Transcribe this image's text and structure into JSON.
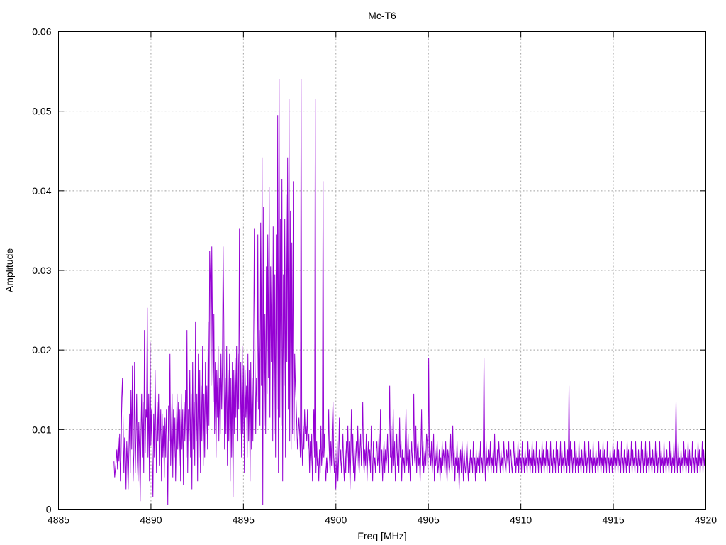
{
  "chart_data": {
    "type": "line",
    "title": "Mc-T6",
    "xlabel": "Freq [MHz]",
    "ylabel": "Amplitude",
    "xlim": [
      4885,
      4920
    ],
    "ylim": [
      0,
      0.06
    ],
    "xticks": [
      4885,
      4890,
      4895,
      4900,
      4905,
      4910,
      4915,
      4920
    ],
    "xtick_labels": [
      "4885",
      "4890",
      "4895",
      "4900",
      "4905",
      "4910",
      "4915",
      "4920"
    ],
    "yticks": [
      0,
      0.01,
      0.02,
      0.03,
      0.04,
      0.05,
      0.06
    ],
    "ytick_labels": [
      "0",
      "0.01",
      "0.02",
      "0.03",
      "0.04",
      "0.05",
      "0.06"
    ],
    "grid": true,
    "series_color": "#9400d3",
    "series": [
      {
        "x_range": [
          4888.0,
          4920.0
        ],
        "values": [
          0.006,
          0.004,
          0.005,
          0.006,
          0.0075,
          0.005,
          0.009,
          0.006,
          0.0095,
          0.0035,
          0.007,
          0.014,
          0.0165,
          0.0105,
          0.0045,
          0.009,
          0.0075,
          0.0025,
          0.0085,
          0.006,
          0.0025,
          0.007,
          0.012,
          0.0045,
          0.015,
          0.0075,
          0.018,
          0.0035,
          0.007,
          0.0185,
          0.0045,
          0.009,
          0.0145,
          0.006,
          0.0035,
          0.011,
          0.0075,
          0.001,
          0.009,
          0.0145,
          0.0065,
          0.0135,
          0.0045,
          0.0225,
          0.007,
          0.0125,
          0.0115,
          0.0253,
          0.0065,
          0.0145,
          0.0035,
          0.021,
          0.008,
          0.0125,
          0.0065,
          0.0015,
          0.012,
          0.0065,
          0.0175,
          0.0105,
          0.0045,
          0.0135,
          0.0085,
          0.0145,
          0.0055,
          0.009,
          0.0125,
          0.0035,
          0.012,
          0.0065,
          0.0105,
          0.004,
          0.0115,
          0.0065,
          0.0125,
          0.0085,
          0.0005,
          0.013,
          0.0085,
          0.0195,
          0.0055,
          0.0095,
          0.0145,
          0.004,
          0.0125,
          0.0065,
          0.0115,
          0.0035,
          0.009,
          0.0145,
          0.0075,
          0.0135,
          0.0055,
          0.0125,
          0.0035,
          0.0145,
          0.0075,
          0.0125,
          0.003,
          0.0135,
          0.0085,
          0.015,
          0.0065,
          0.0225,
          0.0045,
          0.0125,
          0.0085,
          0.0175,
          0.0065,
          0.0145,
          0.0025,
          0.0185,
          0.0075,
          0.0135,
          0.0055,
          0.0235,
          0.0085,
          0.0145,
          0.0035,
          0.0195,
          0.0065,
          0.0175,
          0.0045,
          0.0155,
          0.0085,
          0.0205,
          0.0055,
          0.0145,
          0.0065,
          0.0185,
          0.0095,
          0.0155,
          0.0075,
          0.0235,
          0.0105,
          0.0325,
          0.0285,
          0.0155,
          0.033,
          0.0225,
          0.0135,
          0.0245,
          0.0095,
          0.0185,
          0.0065,
          0.0175,
          0.0115,
          0.0205,
          0.0085,
          0.0165,
          0.0095,
          0.0195,
          0.0125,
          0.018,
          0.0095,
          0.0235,
          0.0075,
          0.0165,
          0.0095,
          0.0205,
          0.0055,
          0.0175,
          0.0085,
          0.0195,
          0.0035,
          0.0165,
          0.0065,
          0.0185,
          0.0015,
          0.0175,
          0.0095,
          0.019,
          0.0115,
          0.0205,
          0.0085,
          0.0195,
          0.0125,
          0.0353,
          0.0095,
          0.0185,
          0.0065,
          0.0205,
          0.0095,
          0.018,
          0.0045,
          0.0175,
          0.0115,
          0.0155,
          0.0065,
          0.0195,
          0.0085,
          0.0175,
          0.0035,
          0.0185,
          0.0075,
          0.0165,
          0.0085,
          0.0195,
          0.0115,
          0.0185,
          0.0095,
          0.0165,
          0.0135,
          0.0345,
          0.0125,
          0.0225,
          0.0105,
          0.036,
          0.0155,
          0.0442,
          0.0005,
          0.038,
          0.0105,
          0.0245,
          0.0095,
          0.0305,
          0.0145,
          0.0345,
          0.0165,
          0.0405,
          0.0115,
          0.0305,
          0.0185,
          0.0355,
          0.0085,
          0.0355,
          0.0095,
          0.0295,
          0.0065,
          0.0345,
          0.0125,
          0.0495,
          0.0045,
          0.054,
          0.0115,
          0.0365,
          0.0105,
          0.0415,
          0.0035,
          0.0295,
          0.0155,
          0.0365,
          0.0065,
          0.0395,
          0.0185,
          0.0335,
          0.0125,
          0.0515,
          0.0085,
          0.0375,
          0.0075,
          0.0335,
          0.0095,
          0.0412,
          0.0085,
          0.0195,
          0.0155,
          0.0135,
          0.0105,
          0.0075,
          0.0095,
          0.0115,
          0.0095,
          0.0065,
          0.0035,
          0.0085,
          0.0055,
          0.0105,
          0.0075,
          0.0125,
          0.0095,
          0.0105,
          0.0085,
          0.0125,
          0.0075,
          0.0095,
          0.0045,
          0.0085,
          0.0055,
          0.0095,
          0.0035,
          0.0075,
          0.0125,
          0.0065,
          0.0145,
          0.0045,
          0.0085,
          0.0055,
          0.0065,
          0.0035,
          0.0075,
          0.0045,
          0.0105,
          0.0055,
          0.0075,
          0.0025,
          0.0065,
          0.0095,
          0.0055,
          0.0035,
          0.0065,
          0.0045,
          0.0075,
          0.0125,
          0.0065,
          0.0045,
          0.0085,
          0.0055,
          0.0105,
          0.0135,
          0.0065,
          0.0045,
          0.0075,
          0.0025,
          0.0055,
          0.0085,
          0.0035,
          0.0065,
          0.0115,
          0.0055,
          0.0075,
          0.0045,
          0.0065,
          0.0095,
          0.0055,
          0.0035,
          0.0075,
          0.0045,
          0.0085,
          0.0065,
          0.0105,
          0.0045,
          0.0085,
          0.0025,
          0.0065,
          0.0125,
          0.0055,
          0.0095,
          0.0045,
          0.0075,
          0.0035,
          0.0065,
          0.0085,
          0.0055,
          0.0105,
          0.0065,
          0.0045,
          0.0075,
          0.0095,
          0.0055,
          0.0085,
          0.0135,
          0.0065,
          0.0045,
          0.0075,
          0.0055,
          0.0095,
          0.0035,
          0.0065,
          0.0085,
          0.0055,
          0.0075,
          0.0045,
          0.0105,
          0.0065,
          0.0035,
          0.0085,
          0.0055,
          0.0065,
          0.0045,
          0.0075,
          0.0085,
          0.0055,
          0.0065,
          0.0095,
          0.0045,
          0.0125,
          0.0055,
          0.0075,
          0.0035,
          0.0065,
          0.0085,
          0.0045,
          0.0075,
          0.0055,
          0.0065,
          0.0095,
          0.0045,
          0.0085,
          0.0155,
          0.0065,
          0.0105,
          0.0045,
          0.0075,
          0.0125,
          0.0055,
          0.0085,
          0.0035,
          0.0065,
          0.0095,
          0.0055,
          0.0075,
          0.0045,
          0.0115,
          0.0065,
          0.0085,
          0.0035,
          0.0075,
          0.0055,
          0.0065,
          0.0045,
          0.0085,
          0.0125,
          0.0055,
          0.0065,
          0.0095,
          0.0045,
          0.0075,
          0.0035,
          0.0065,
          0.0085,
          0.0055,
          0.0075,
          0.0145,
          0.0065,
          0.0055,
          0.0105,
          0.0045,
          0.0075,
          0.0085,
          0.0055,
          0.0065,
          0.0035,
          0.0075,
          0.0125,
          0.0055,
          0.0085,
          0.0045,
          0.0065,
          0.0075,
          0.0055,
          0.0095,
          0.0085,
          0.0045,
          0.019,
          0.0065,
          0.0075,
          0.0055,
          0.0085,
          0.0045,
          0.0065,
          0.0095,
          0.0035,
          0.0075,
          0.0055,
          0.0065,
          0.0085,
          0.0045,
          0.0055,
          0.0075,
          0.0035,
          0.0065,
          0.0045,
          0.0085,
          0.0055,
          0.0075,
          0.0065,
          0.0045,
          0.0085,
          0.0055,
          0.0035,
          0.0075,
          0.0065,
          0.0045,
          0.0055,
          0.0095,
          0.0065,
          0.0045,
          0.0105,
          0.0055,
          0.0075,
          0.0035,
          0.0065,
          0.0055,
          0.0085,
          0.0045,
          0.0065,
          0.0025,
          0.0055,
          0.0075,
          0.0045,
          0.0085,
          0.0065,
          0.0035,
          0.0075,
          0.0055,
          0.0045,
          0.0065,
          0.0085,
          0.0055,
          0.0035,
          0.0065,
          0.0045,
          0.0075,
          0.0055,
          0.0065,
          0.0045,
          0.0085,
          0.0055,
          0.0065,
          0.0035,
          0.0075,
          0.0045,
          0.0065,
          0.0055,
          0.0075,
          0.0045,
          0.0085,
          0.0055,
          0.0065,
          0.0045,
          0.0075,
          0.0055,
          0.0065,
          0.0035,
          0.0085,
          0.0055,
          0.0065,
          0.0045,
          0.0075,
          0.0055,
          0.0085,
          0.0045,
          0.0065,
          0.0055,
          0.0075,
          0.0045,
          0.0095,
          0.0055,
          0.0065,
          0.0045,
          0.0075,
          0.0055,
          0.0085,
          0.0065,
          0.0045,
          0.0075,
          0.0055,
          0.0065,
          0.0045,
          0.0085,
          0.0065,
          0.0055,
          0.0045,
          0.0075,
          0.0065,
          0.0055,
          0.0085,
          0.0045,
          0.0065,
          0.0075,
          0.0055,
          0.0045,
          0.0065,
          0.0085,
          0.0055,
          0.0075,
          0.0045,
          0.0065,
          0.0055,
          0.0085,
          0.0045,
          0.0075,
          0.0055,
          0.0065,
          0.0045,
          0.0085,
          0.0055,
          0.0065,
          0.0045,
          0.0075,
          0.0055,
          0.0065,
          0.0045,
          0.0085,
          0.0055,
          0.0075,
          0.0045,
          0.0065,
          0.0055,
          0.0085,
          0.0045,
          0.0075,
          0.0055,
          0.0065,
          0.0045,
          0.0085,
          0.0055,
          0.0065,
          0.0045,
          0.0075,
          0.0055,
          0.0065,
          0.0045,
          0.0085,
          0.0055,
          0.0075,
          0.0045,
          0.0065,
          0.0055,
          0.0085,
          0.0045,
          0.0075,
          0.0055,
          0.0065,
          0.0045,
          0.0085,
          0.0055,
          0.0065,
          0.0045,
          0.0075,
          0.0055,
          0.0065,
          0.0045,
          0.0085,
          0.0055,
          0.0075,
          0.0045,
          0.0065,
          0.0055,
          0.0085,
          0.0045,
          0.0075,
          0.0055,
          0.0065,
          0.0045,
          0.0085,
          0.0055,
          0.0065,
          0.0045,
          0.0075,
          0.0055,
          0.0065,
          0.0045,
          0.0085,
          0.0055,
          0.0075,
          0.0045,
          0.0065,
          0.0055,
          0.0085,
          0.0045,
          0.0075,
          0.0055,
          0.0065,
          0.0045,
          0.0085,
          0.0055,
          0.0065,
          0.0045,
          0.0075,
          0.0055,
          0.0065,
          0.0045,
          0.0085,
          0.0055,
          0.0075,
          0.0045,
          0.0065,
          0.0055,
          0.0085,
          0.0045,
          0.0075,
          0.0055,
          0.0065,
          0.0045,
          0.0085,
          0.0055,
          0.0065,
          0.0045,
          0.0075,
          0.0055,
          0.0065,
          0.0045,
          0.0085,
          0.0055,
          0.0075,
          0.0045,
          0.0065,
          0.0055,
          0.0085,
          0.0045,
          0.0075,
          0.0055,
          0.0065,
          0.0045,
          0.0085,
          0.0055,
          0.0065,
          0.0045,
          0.0075,
          0.0055,
          0.0065,
          0.0045,
          0.0085,
          0.0055,
          0.0075,
          0.0045,
          0.0065,
          0.0055,
          0.0085,
          0.0045,
          0.0075,
          0.0055,
          0.0065,
          0.0045,
          0.0085,
          0.0055,
          0.0065,
          0.0045,
          0.0075,
          0.0055,
          0.0065,
          0.0045,
          0.0085,
          0.0055,
          0.0075,
          0.0045,
          0.0065,
          0.0055,
          0.0085,
          0.0045,
          0.0075,
          0.0055,
          0.0065,
          0.0045,
          0.0085,
          0.0055,
          0.0065,
          0.0045,
          0.0075,
          0.0055,
          0.0065,
          0.0045,
          0.0085,
          0.0055,
          0.0075,
          0.0045,
          0.0065,
          0.0055,
          0.0085,
          0.0045,
          0.0075,
          0.0055,
          0.0065,
          0.0045,
          0.0085,
          0.0055,
          0.0065,
          0.0045,
          0.0075,
          0.0055,
          0.0065,
          0.0045,
          0.0085,
          0.0055,
          0.0075,
          0.0045,
          0.0065,
          0.0055,
          0.0085,
          0.0045,
          0.0075,
          0.0055,
          0.0065,
          0.0045,
          0.0085,
          0.0055,
          0.0065,
          0.0045,
          0.0075,
          0.0055,
          0.0065,
          0.0045,
          0.0085,
          0.0055,
          0.0075,
          0.0045,
          0.0065,
          0.0055,
          0.0085,
          0.0045,
          0.0075,
          0.0055,
          0.0065,
          0.0045,
          0.0085,
          0.0055,
          0.0065,
          0.0045,
          0.0075,
          0.0055,
          0.0065,
          0.0045,
          0.0085,
          0.0055,
          0.0075,
          0.0045,
          0.0065,
          0.0055,
          0.0085,
          0.0045,
          0.0075,
          0.0055,
          0.0065,
          0.0045,
          0.0085,
          0.0055,
          0.0065,
          0.0045,
          0.0075,
          0.0055,
          0.0065,
          0.0045,
          0.0085,
          0.0055,
          0.0075,
          0.0045,
          0.0065,
          0.0055,
          0.0085,
          0.0045,
          0.0075,
          0.0055,
          0.0065,
          0.0045
        ]
      }
    ],
    "peaks": [
      {
        "x": 4889.8,
        "y": 0.0253
      },
      {
        "x": 4893.9,
        "y": 0.033
      },
      {
        "x": 4895.6,
        "y": 0.0353
      },
      {
        "x": 4897.4,
        "y": 0.0442
      },
      {
        "x": 4898.1,
        "y": 0.054
      },
      {
        "x": 4898.9,
        "y": 0.0515
      },
      {
        "x": 4899.3,
        "y": 0.0412
      },
      {
        "x": 4908.0,
        "y": 0.019
      },
      {
        "x": 4912.6,
        "y": 0.0155
      },
      {
        "x": 4918.4,
        "y": 0.0135
      }
    ]
  }
}
